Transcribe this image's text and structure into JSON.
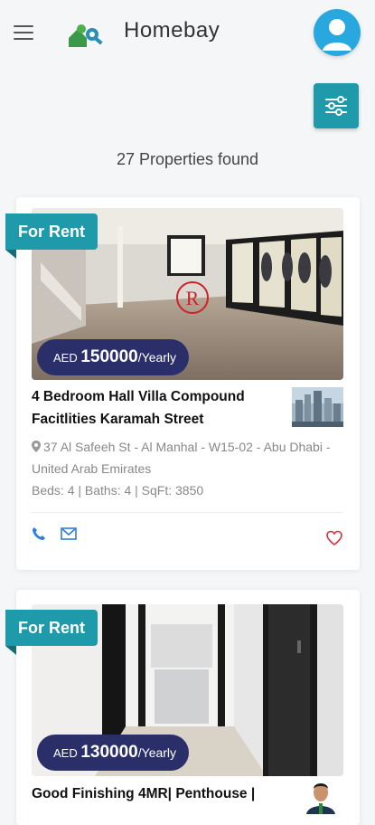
{
  "header": {
    "title": "Homebay",
    "menu_icon": "hamburger-icon",
    "logo_icon": "keys-logo-icon",
    "avatar_icon": "user-avatar-icon"
  },
  "filter": {
    "icon": "sliders-icon"
  },
  "results": {
    "count_text": "27 Properties found"
  },
  "colors": {
    "accent": "#1f9aaa",
    "price_bg": "#2a2f6a",
    "icon_blue": "#2a7de1",
    "heart_red": "#d9303f"
  },
  "listings": [
    {
      "tag": "For Rent",
      "price_currency": "AED ",
      "price_amount": "150000",
      "price_period": "/Yearly",
      "title": "4 Bedroom Hall Villa Compound Facitlities Karamah Street",
      "address": "37 Al Safeeh St - Al Manhal - W15-02 - Abu Dhabi - United Arab Emirates",
      "features": "Beds: 4 | Baths: 4 | SqFt: 3850",
      "watermark": "R"
    },
    {
      "tag": "For Rent",
      "price_currency": "AED ",
      "price_amount": "130000",
      "price_period": "/Yearly",
      "title": "Good Finishing 4MR| Penthouse |"
    }
  ]
}
